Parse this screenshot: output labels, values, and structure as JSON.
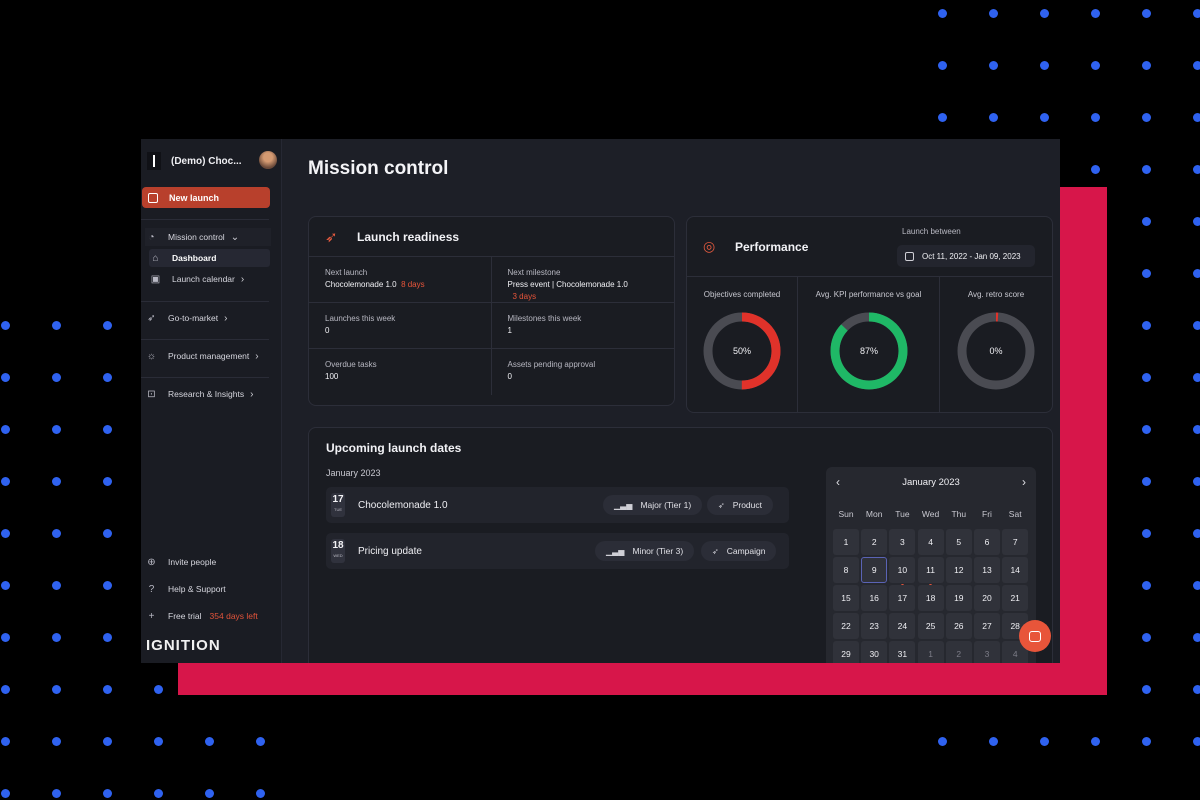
{
  "workspace": {
    "name": "(Demo) Choc..."
  },
  "sidebar": {
    "new_launch": "New launch",
    "mission_control": "Mission control",
    "dashboard": "Dashboard",
    "launch_calendar": "Launch calendar",
    "items": [
      "Go-to-market",
      "Product management",
      "Research & Insights"
    ],
    "invite": "Invite people",
    "help": "Help & Support",
    "trial": "Free trial",
    "trial_left": "354 days left",
    "brand": "IGNITION"
  },
  "page": {
    "title": "Mission control"
  },
  "launch_readiness": {
    "title": "Launch readiness",
    "cells": [
      {
        "k": "Next launch",
        "v": "Chocolemonade 1.0",
        "extra": "8 days"
      },
      {
        "k": "Next milestone",
        "v": "Press event | Chocolemonade 1.0",
        "extra": "3 days"
      },
      {
        "k": "Launches this week",
        "v": "0"
      },
      {
        "k": "Milestones this week",
        "v": "1"
      },
      {
        "k": "Overdue tasks",
        "v": "100"
      },
      {
        "k": "Assets pending approval",
        "v": "0"
      }
    ]
  },
  "performance": {
    "title": "Performance",
    "between_label": "Launch between",
    "date_range": "Oct 11, 2022 - Jan 09, 2023",
    "metrics": [
      {
        "label": "Objectives completed",
        "value": "50%",
        "fraction": 0.5,
        "color": "#e0322a"
      },
      {
        "label": "Avg. KPI performance vs goal",
        "value": "87%",
        "fraction": 0.87,
        "color": "#1fb866"
      },
      {
        "label": "Avg. retro score",
        "value": "0%",
        "fraction": 0,
        "color": "#e0322a"
      }
    ]
  },
  "upcoming": {
    "title": "Upcoming launch dates",
    "month": "January 2023",
    "rows": [
      {
        "day": "17",
        "weekday": "TUE",
        "name": "Chocolemonade 1.0",
        "tier": "Major (Tier 1)",
        "type": "Product"
      },
      {
        "day": "18",
        "weekday": "WED",
        "name": "Pricing update",
        "tier": "Minor (Tier 3)",
        "type": "Campaign"
      }
    ]
  },
  "calendar": {
    "month": "January 2023",
    "weekdays": [
      "Sun",
      "Mon",
      "Tue",
      "Wed",
      "Thu",
      "Fri",
      "Sat"
    ],
    "weeks": [
      [
        "1",
        "2",
        "3",
        "4",
        "5",
        "6",
        "7"
      ],
      [
        "8",
        "9",
        "10",
        "11",
        "12",
        "13",
        "14"
      ],
      [
        "15",
        "16",
        "17",
        "18",
        "19",
        "20",
        "21"
      ],
      [
        "22",
        "23",
        "24",
        "25",
        "26",
        "27",
        "28"
      ],
      [
        "29",
        "30",
        "31",
        "1",
        "2",
        "3",
        "4"
      ]
    ],
    "today": "9",
    "marked": [
      "10",
      "11"
    ]
  }
}
